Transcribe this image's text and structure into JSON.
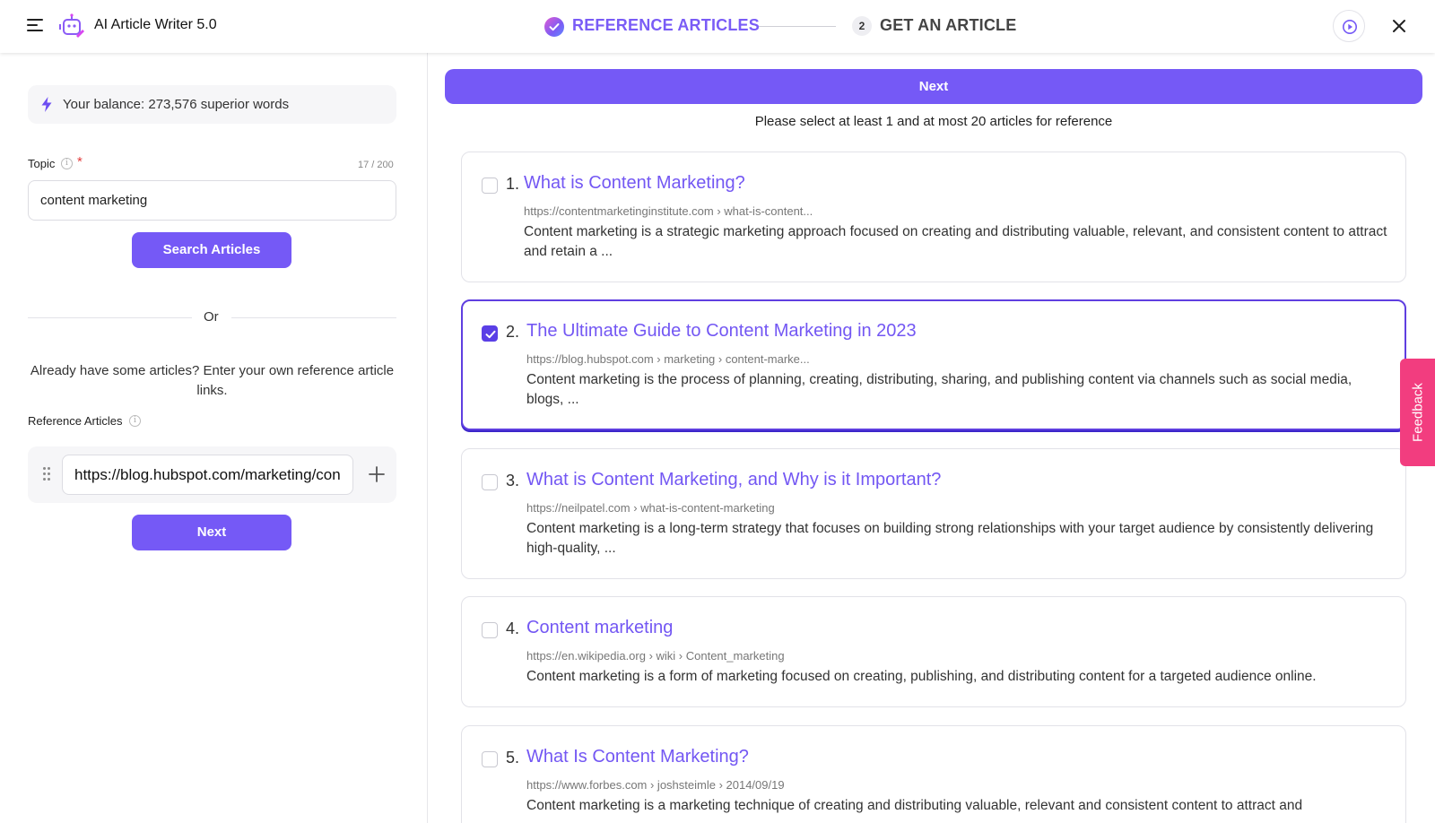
{
  "header": {
    "app_title": "AI Article Writer 5.0",
    "step1_label": "REFERENCE ARTICLES",
    "step2_number": "2",
    "step2_label": "GET AN ARTICLE"
  },
  "left": {
    "balance_text": "Your balance: 273,576 superior words",
    "topic_label": "Topic",
    "topic_required": "*",
    "topic_char_count": "17 / 200",
    "topic_value": "content marketing",
    "search_button": "Search Articles",
    "or_text": "Or",
    "already_text": "Already have some articles? Enter your own reference article links.",
    "reference_label": "Reference Articles",
    "reference_value": "https://blog.hubspot.com/marketing/content-marketing",
    "next_button": "Next"
  },
  "right": {
    "next_button": "Next",
    "instruction": "Please select at least 1 and at most 20 articles for reference",
    "articles": [
      {
        "number": "1.",
        "title": "What is Content Marketing?",
        "url": "https://contentmarketinginstitute.com › what-is-content...",
        "snippet": "Content marketing is a strategic marketing approach focused on creating and distributing valuable, relevant, and consistent content to attract and retain a ...",
        "selected": false
      },
      {
        "number": "2.",
        "title": "The Ultimate Guide to Content Marketing in 2023",
        "url": "https://blog.hubspot.com › marketing › content-marke...",
        "snippet": "Content marketing is the process of planning, creating, distributing, sharing, and publishing content via channels such as social media, blogs, ...",
        "selected": true
      },
      {
        "number": "3.",
        "title": "What is Content Marketing, and Why is it Important?",
        "url": "https://neilpatel.com › what-is-content-marketing",
        "snippet": "Content marketing is a long-term strategy that focuses on building strong relationships with your target audience by consistently delivering high-quality, ...",
        "selected": false
      },
      {
        "number": "4.",
        "title": "Content marketing",
        "url": "https://en.wikipedia.org › wiki › Content_marketing",
        "snippet": "Content marketing is a form of marketing focused on creating, publishing, and distributing content for a targeted audience online.",
        "selected": false
      },
      {
        "number": "5.",
        "title": "What Is Content Marketing?",
        "url": "https://www.forbes.com › joshsteimle › 2014/09/19",
        "snippet": "Content marketing is a marketing technique of creating and distributing valuable, relevant and consistent content to attract and",
        "selected": false
      }
    ]
  },
  "feedback_label": "Feedback",
  "colors": {
    "accent": "#7559f6",
    "selected_border": "#5f3fe0",
    "feedback": "#f23d7f"
  }
}
